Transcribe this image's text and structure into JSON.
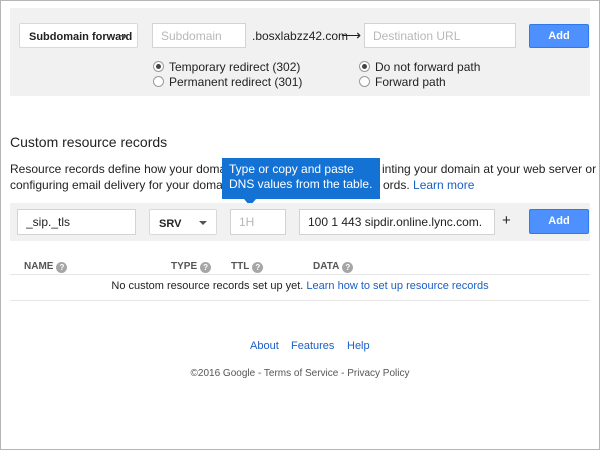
{
  "forward": {
    "type_select": "Subdomain forward",
    "subdomain_placeholder": "Subdomain",
    "domain_text": ".bosxlabzz42.com",
    "arrow": "⟶",
    "destination_placeholder": "Destination URL",
    "add_label": "Add",
    "redirect_options": [
      {
        "label": "Temporary redirect (302)",
        "selected": true
      },
      {
        "label": "Permanent redirect (301)",
        "selected": false
      }
    ],
    "path_options": [
      {
        "label": "Do not forward path",
        "selected": true
      },
      {
        "label": "Forward path",
        "selected": false
      }
    ]
  },
  "records": {
    "title": "Custom resource records",
    "desc_line1_a": "Resource records define how your domain b",
    "desc_line1_b": "inting your domain at your web server or",
    "desc_line2_a": "configuring email delivery for your domain. Y",
    "desc_line2_b": "ords.",
    "learn_more": "Learn more",
    "tooltip": "Type or copy and paste DNS values from the table.",
    "name_value": "_sip._tls",
    "type_value": "SRV",
    "ttl_placeholder": "1H",
    "data_value": "100 1 443 sipdir.online.lync.com.",
    "plus": "+",
    "add_label": "Add",
    "columns": [
      "NAME",
      "TYPE",
      "TTL",
      "DATA"
    ],
    "help_glyph": "?",
    "empty_text": "No custom resource records set up yet.",
    "empty_link": "Learn how to set up resource records"
  },
  "footer": {
    "links": [
      "About",
      "Features",
      "Help"
    ],
    "copyright": "©2016 Google - Terms of Service - Privacy Policy"
  }
}
